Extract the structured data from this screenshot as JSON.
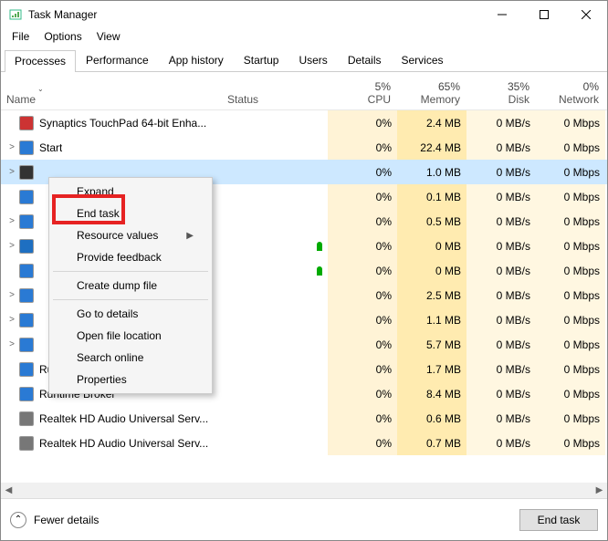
{
  "window": {
    "title": "Task Manager"
  },
  "menu": [
    "File",
    "Options",
    "View"
  ],
  "tabs": [
    "Processes",
    "Performance",
    "App history",
    "Startup",
    "Users",
    "Details",
    "Services"
  ],
  "columns": {
    "name": "Name",
    "status": "Status",
    "cpu": {
      "pct": "5%",
      "label": "CPU"
    },
    "memory": {
      "pct": "65%",
      "label": "Memory"
    },
    "disk": {
      "pct": "35%",
      "label": "Disk"
    },
    "network": {
      "pct": "0%",
      "label": "Network"
    }
  },
  "rows": [
    {
      "exp": "",
      "icon": "#c33",
      "name": "Synaptics TouchPad 64-bit Enha...",
      "cpu": "0%",
      "mem": "2.4 MB",
      "disk": "0 MB/s",
      "net": "0 Mbps",
      "leaf": false,
      "sel": false
    },
    {
      "exp": ">",
      "icon": "#2a7ad4",
      "name": "Start",
      "cpu": "0%",
      "mem": "22.4 MB",
      "disk": "0 MB/s",
      "net": "0 Mbps",
      "leaf": false,
      "sel": false
    },
    {
      "exp": ">",
      "icon": "#333",
      "name": "",
      "cpu": "0%",
      "mem": "1.0 MB",
      "disk": "0 MB/s",
      "net": "0 Mbps",
      "leaf": false,
      "sel": true
    },
    {
      "exp": "",
      "icon": "#2a7ad4",
      "name": "",
      "cpu": "0%",
      "mem": "0.1 MB",
      "disk": "0 MB/s",
      "net": "0 Mbps",
      "leaf": false,
      "sel": false
    },
    {
      "exp": ">",
      "icon": "#2a7ad4",
      "name": "",
      "cpu": "0%",
      "mem": "0.5 MB",
      "disk": "0 MB/s",
      "net": "0 Mbps",
      "leaf": false,
      "sel": false
    },
    {
      "exp": ">",
      "icon": "#1e6fc1",
      "name": "",
      "cpu": "0%",
      "mem": "0 MB",
      "disk": "0 MB/s",
      "net": "0 Mbps",
      "leaf": true,
      "sel": false
    },
    {
      "exp": "",
      "icon": "#2a7ad4",
      "name": "",
      "cpu": "0%",
      "mem": "0 MB",
      "disk": "0 MB/s",
      "net": "0 Mbps",
      "leaf": true,
      "sel": false
    },
    {
      "exp": ">",
      "icon": "#2a7ad4",
      "name": "",
      "cpu": "0%",
      "mem": "2.5 MB",
      "disk": "0 MB/s",
      "net": "0 Mbps",
      "leaf": false,
      "sel": false
    },
    {
      "exp": ">",
      "icon": "#2a7ad4",
      "name": "",
      "cpu": "0%",
      "mem": "1.1 MB",
      "disk": "0 MB/s",
      "net": "0 Mbps",
      "leaf": false,
      "sel": false
    },
    {
      "exp": ">",
      "icon": "#2a7ad4",
      "name": "",
      "cpu": "0%",
      "mem": "5.7 MB",
      "disk": "0 MB/s",
      "net": "0 Mbps",
      "leaf": false,
      "sel": false
    },
    {
      "exp": "",
      "icon": "#2a7ad4",
      "name": "Runtime Broker",
      "cpu": "0%",
      "mem": "1.7 MB",
      "disk": "0 MB/s",
      "net": "0 Mbps",
      "leaf": false,
      "sel": false
    },
    {
      "exp": "",
      "icon": "#2a7ad4",
      "name": "Runtime Broker",
      "cpu": "0%",
      "mem": "8.4 MB",
      "disk": "0 MB/s",
      "net": "0 Mbps",
      "leaf": false,
      "sel": false
    },
    {
      "exp": "",
      "icon": "#777",
      "name": "Realtek HD Audio Universal Serv...",
      "cpu": "0%",
      "mem": "0.6 MB",
      "disk": "0 MB/s",
      "net": "0 Mbps",
      "leaf": false,
      "sel": false
    },
    {
      "exp": "",
      "icon": "#777",
      "name": "Realtek HD Audio Universal Serv...",
      "cpu": "0%",
      "mem": "0.7 MB",
      "disk": "0 MB/s",
      "net": "0 Mbps",
      "leaf": false,
      "sel": false
    }
  ],
  "context_menu": {
    "items": [
      {
        "label": "Expand",
        "sub": false
      },
      {
        "label": "End task",
        "sub": false
      },
      {
        "label": "Resource values",
        "sub": true
      },
      {
        "label": "Provide feedback",
        "sub": false
      },
      "-",
      {
        "label": "Create dump file",
        "sub": false
      },
      "-",
      {
        "label": "Go to details",
        "sub": false
      },
      {
        "label": "Open file location",
        "sub": false
      },
      {
        "label": "Search online",
        "sub": false
      },
      {
        "label": "Properties",
        "sub": false
      }
    ]
  },
  "footer": {
    "fewer_details": "Fewer details",
    "end_task": "End task"
  }
}
